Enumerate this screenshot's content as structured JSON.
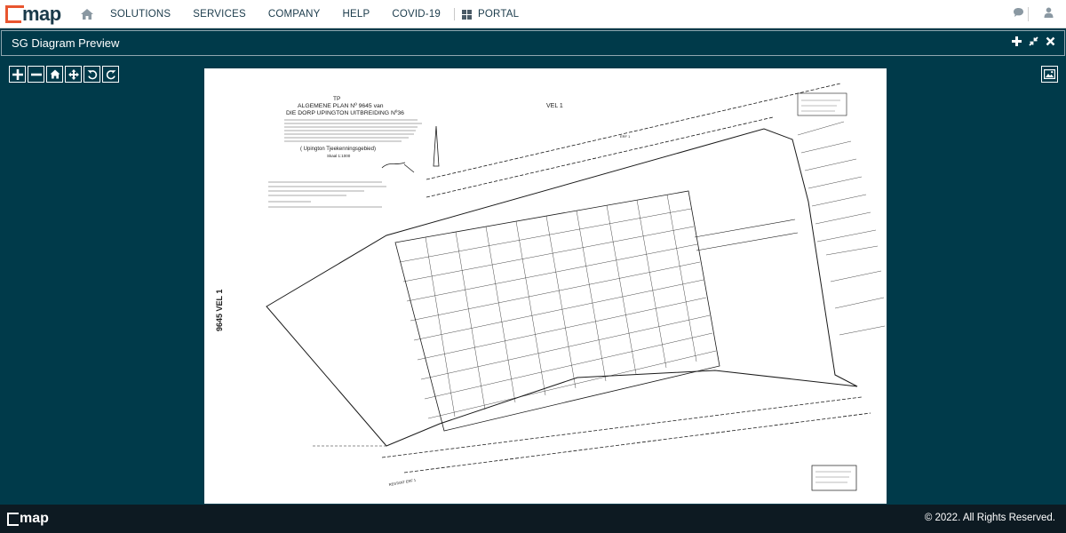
{
  "brand": {
    "logo_text": "map",
    "brand_color": "#e8552f"
  },
  "nav": {
    "items": [
      "SOLUTIONS",
      "SERVICES",
      "COMPANY",
      "HELP",
      "COVID-19"
    ],
    "portal_label": "PORTAL"
  },
  "panel": {
    "title": "SG Diagram Preview"
  },
  "diagram": {
    "header_code": "TP",
    "header_title": "ALGEMENE PLAN Nº 9645 van",
    "header_subtitle": "DIE DORP UPINGTON UITBREIDING Nº36",
    "area_name": "( Upington Tjeekenningsgebied)",
    "scale": "Skaal 1:1000",
    "top_label": "VEL 1",
    "side_label": "9645 VEL 1",
    "erf_label": "ERF 1",
    "road_label_bottom": "RESTANT ERF 1",
    "diagram_colors": {
      "ink": "#1a1a1a",
      "paper": "#ffffff"
    }
  },
  "footer": {
    "logo_text": "map",
    "copyright": "© 2022. All Rights Reserved."
  },
  "colors": {
    "page_bg": "#003a4a",
    "footer_bg": "#0d1a22",
    "nav_text": "#1b3b4b"
  }
}
